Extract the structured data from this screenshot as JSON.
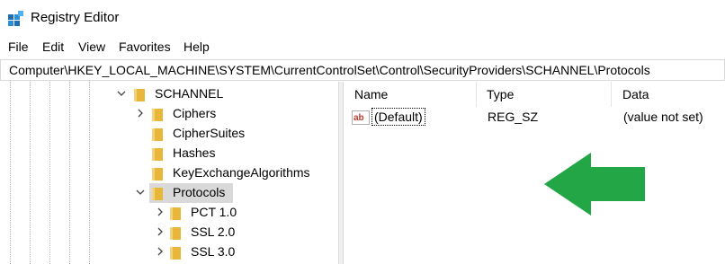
{
  "window": {
    "title": "Registry Editor",
    "app_icon": "regedit-icon"
  },
  "menu": {
    "items": [
      {
        "label": "File"
      },
      {
        "label": "Edit"
      },
      {
        "label": "View"
      },
      {
        "label": "Favorites"
      },
      {
        "label": "Help"
      }
    ]
  },
  "address": {
    "path": "Computer\\HKEY_LOCAL_MACHINE\\SYSTEM\\CurrentControlSet\\Control\\SecurityProviders\\SCHANNEL\\Protocols"
  },
  "tree": {
    "items": [
      {
        "label": "SCHANNEL",
        "expander": "expanded",
        "selected": false
      },
      {
        "label": "Ciphers",
        "expander": "collapsed",
        "selected": false
      },
      {
        "label": "CipherSuites",
        "expander": "none",
        "selected": false
      },
      {
        "label": "Hashes",
        "expander": "none",
        "selected": false
      },
      {
        "label": "KeyExchangeAlgorithms",
        "expander": "none",
        "selected": false
      },
      {
        "label": "Protocols",
        "expander": "expanded",
        "selected": true
      },
      {
        "label": "PCT 1.0",
        "expander": "collapsed",
        "selected": false
      },
      {
        "label": "SSL 2.0",
        "expander": "collapsed",
        "selected": false
      },
      {
        "label": "SSL 3.0",
        "expander": "collapsed",
        "selected": false
      }
    ]
  },
  "values_list": {
    "headers": {
      "name": "Name",
      "type": "Type",
      "data": "Data"
    },
    "rows": [
      {
        "name": "(Default)",
        "type": "REG_SZ",
        "data": "(value not set)",
        "icon": "string-value-icon"
      }
    ]
  },
  "colors": {
    "folder": "#e8b63a",
    "selection": "#d9d9d9",
    "arrow": "#22a646"
  }
}
